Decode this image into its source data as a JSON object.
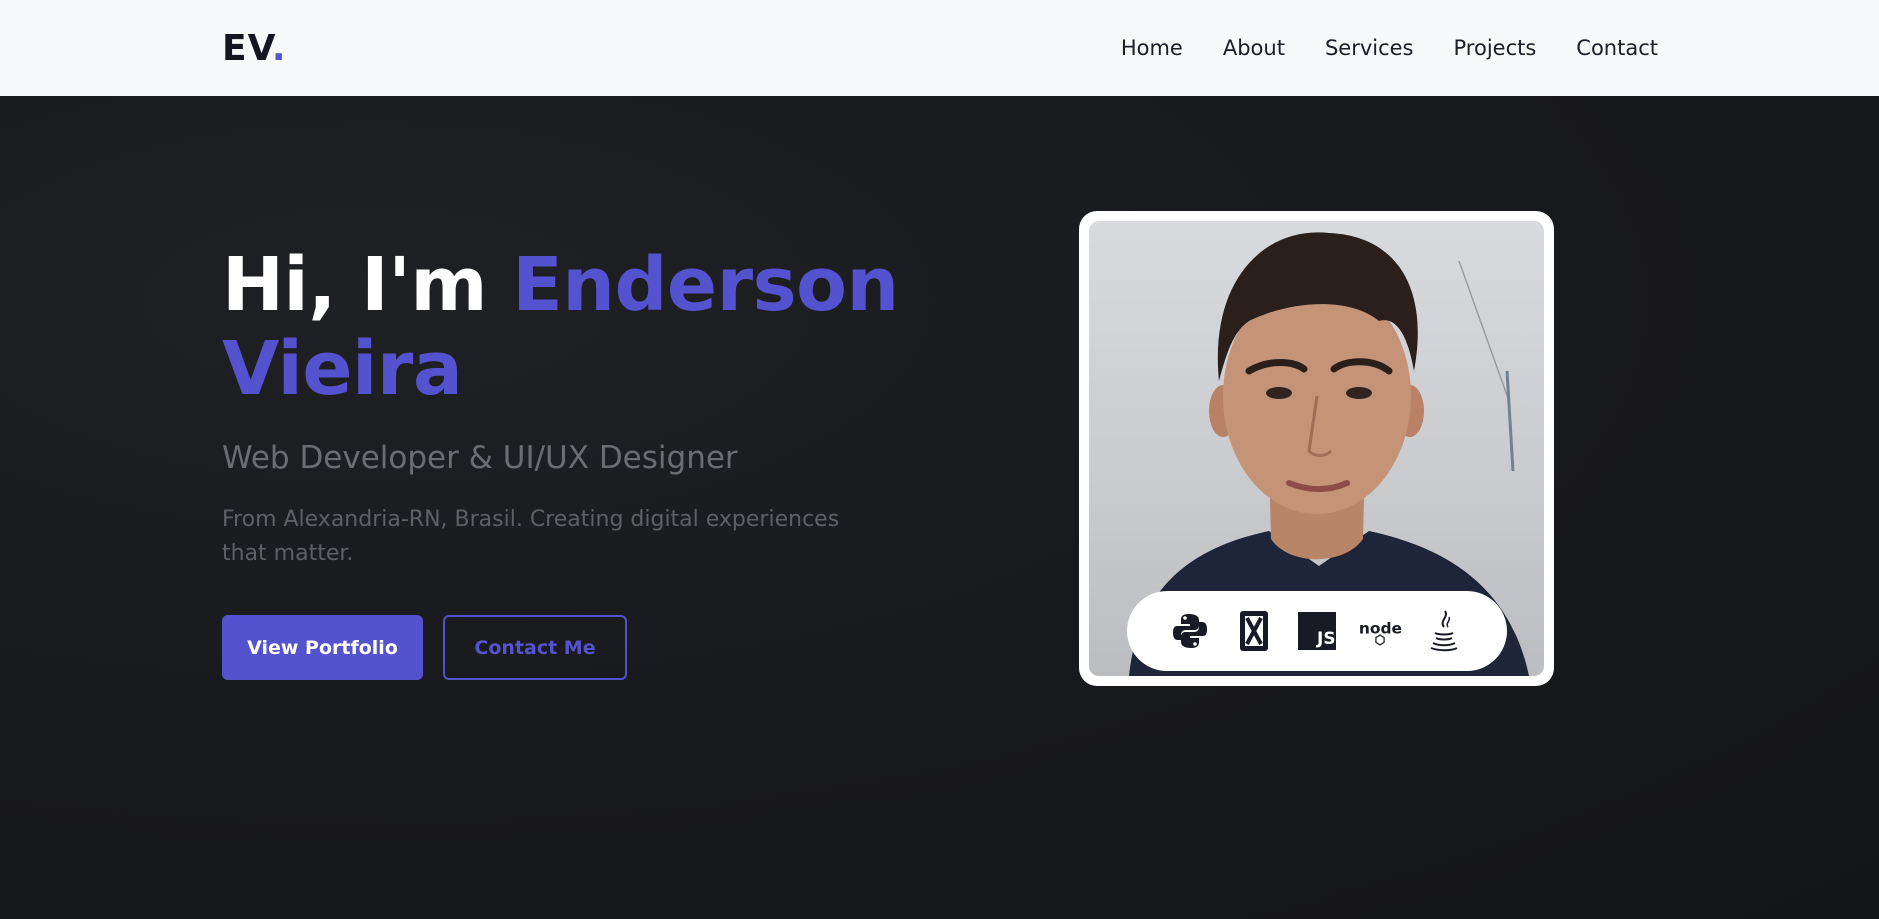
{
  "logo": {
    "text": "EV",
    "dot": "."
  },
  "nav": {
    "items": [
      "Home",
      "About",
      "Services",
      "Projects",
      "Contact"
    ]
  },
  "hero": {
    "greeting": "Hi, I'm ",
    "name": "Enderson Vieira",
    "subtitle": "Web Developer & UI/UX Designer",
    "description": "From Alexandria-RN, Brasil. Creating digital experiences that matter.",
    "primary_button": "View Portfolio",
    "secondary_button": "Contact Me"
  },
  "tech_icons": [
    "python-icon",
    "htmx-icon",
    "javascript-icon",
    "nodejs-icon",
    "java-icon"
  ],
  "colors": {
    "accent": "#5552cf",
    "nav_bg": "#f8f9fa",
    "hero_bg": "#1a1b1f",
    "text_dark": "#141622"
  }
}
